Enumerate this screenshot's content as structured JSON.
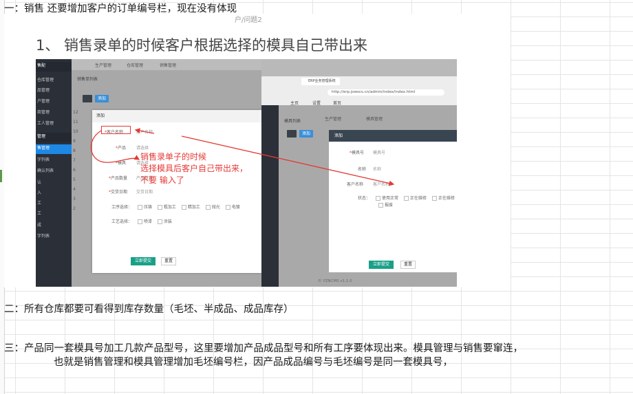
{
  "notes": {
    "n1": "一：销售 还要增加客户的订单编号栏，现在没有体现",
    "n2": "二：所有仓库都要可看得到库存数量（毛坯、半成品、成品库存）",
    "n3a": "三：产品同一套模具号加工几款产品型号，这里要增加产品成品型号和所有工序要体现出来。模具管理与销售要窜连，",
    "n3b": "也就是销售管理和模具管理增加毛坯编号栏，因产品成品编号与毛坯编号是同一套模具号，"
  },
  "slide": {
    "top_text": "户/问题2",
    "title": "1、 销售录单的时候客户根据选择的模具自己带出来",
    "annotation_lines": [
      "销售录单子的时候",
      "选择模具后客户自己带出来，",
      "不要 输入了"
    ],
    "left_app": {
      "sidebar": [
        {
          "label": "售配",
          "header": true
        },
        {
          "label": "仓库管理"
        },
        {
          "label": "品管理"
        },
        {
          "label": "户管理"
        },
        {
          "label": "商管理"
        },
        {
          "label": "工人管理"
        },
        {
          "label": "管理",
          "header": true
        },
        {
          "label": "售管理",
          "active": true
        },
        {
          "label": "字列表"
        },
        {
          "label": "确认列表"
        },
        {
          "label": "认"
        },
        {
          "label": "入"
        },
        {
          "label": "工"
        },
        {
          "label": "工"
        },
        {
          "label": "成"
        },
        {
          "label": "字列表"
        }
      ],
      "tabs": [
        "生产管理",
        "仓库管理",
        "销售管理"
      ],
      "list_title": "销售单列表",
      "add_label": "添加",
      "row_numbers": [
        "12",
        "11",
        "10",
        "9",
        "8",
        "7",
        "6",
        "5",
        "4",
        "3",
        "2"
      ],
      "dialog": {
        "title": "添加",
        "fields": [
          {
            "label": "客户名称",
            "value": "客户名称",
            "required": true
          },
          {
            "label": "产品",
            "value": "请选择",
            "required": true
          },
          {
            "label": "模具",
            "value": "请选择",
            "required": true
          },
          {
            "label": "产品数量",
            "value": "产品数量",
            "required": true
          },
          {
            "label": "交货日期",
            "value": "交货日期",
            "required": true
          }
        ],
        "process_label": "工序选择：",
        "process_options": [
          "压铸",
          "粗加工",
          "精加工",
          "抛光",
          "电镀"
        ],
        "craft_label": "工艺选择：",
        "craft_options": [
          "喷漆",
          "涂装"
        ],
        "submit_label": "立即提交",
        "reset_label": "重置"
      }
    },
    "right_app": {
      "browser_tab": "ERP业务管理系统",
      "url": "http://erp.jowscs.cn/admin/index/index.html",
      "nav": [
        "主页",
        "设置",
        "首页"
      ],
      "tabs": [
        "生产管理",
        "模具管理"
      ],
      "list_title": "模具列表",
      "add_label": "添加",
      "dialog": {
        "title": "添加",
        "fields": [
          {
            "label": "模具号",
            "value": "模具号",
            "required": true
          },
          {
            "label": "名称",
            "value": "名称"
          },
          {
            "label": "客户名称",
            "value": "客户名称"
          }
        ],
        "status_label": "状态：",
        "status_options": [
          "使用正常",
          "正在维修",
          "正在维修",
          "报废"
        ],
        "submit_label": "立即提交",
        "reset_label": "重置"
      },
      "version": "© YZNCMS v1.1.0"
    }
  },
  "colors": {
    "annotation_red": "#e53935",
    "sidebar_dark": "#2b2f38",
    "active_blue": "#1e88e5",
    "submit_green": "#1aa088"
  }
}
